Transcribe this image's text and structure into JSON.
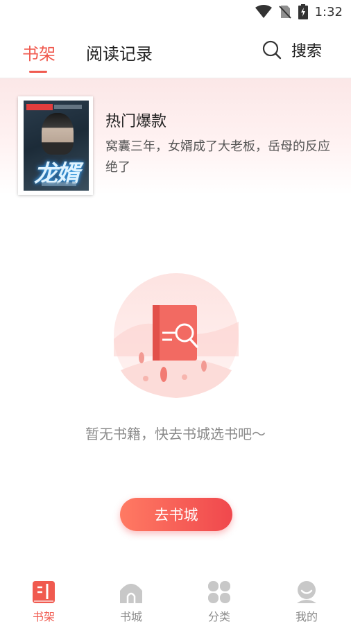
{
  "status_bar": {
    "time": "1:32"
  },
  "top_nav": {
    "tabs": [
      {
        "label": "书架",
        "active": true
      },
      {
        "label": "阅读记录",
        "active": false
      }
    ],
    "search_label": "搜索"
  },
  "promo": {
    "title": "热门爆款",
    "description": "窝囊三年，女婿成了大老板，岳母的反应绝了",
    "cover_text": "龙婿"
  },
  "empty_state": {
    "message": "暂无书籍，快去书城选书吧～",
    "button_label": "去书城"
  },
  "bottom_nav": {
    "items": [
      {
        "label": "书架",
        "icon": "bookshelf-icon",
        "active": true
      },
      {
        "label": "书城",
        "icon": "store-icon",
        "active": false
      },
      {
        "label": "分类",
        "icon": "category-icon",
        "active": false
      },
      {
        "label": "我的",
        "icon": "profile-icon",
        "active": false
      }
    ]
  },
  "colors": {
    "accent": "#f05a4f",
    "inactive": "#c8c8c8",
    "text_muted": "#8a8a8a"
  }
}
